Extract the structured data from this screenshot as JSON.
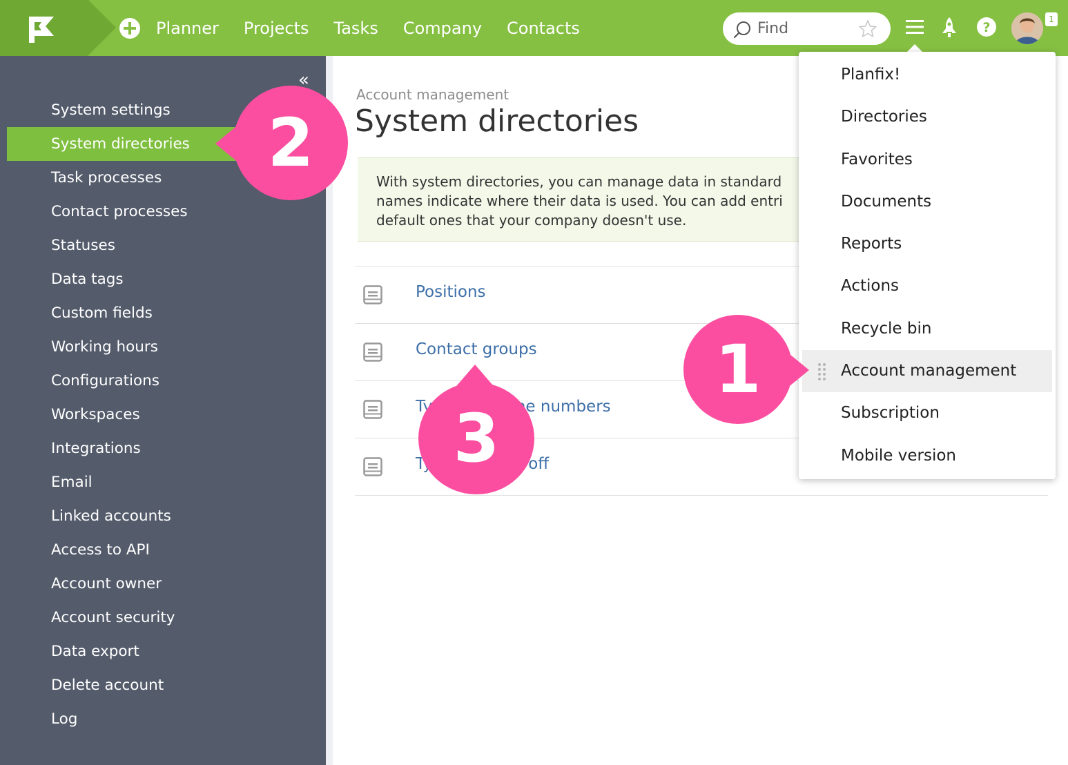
{
  "topbar": {
    "nav": [
      "Planner",
      "Projects",
      "Tasks",
      "Company",
      "Contacts"
    ],
    "search_placeholder": "Find",
    "notification_count": "1"
  },
  "sidebar": {
    "items": [
      "System settings",
      "System directories",
      "Task processes",
      "Contact processes",
      "Statuses",
      "Data tags",
      "Custom fields",
      "Working hours",
      "Configurations",
      "Workspaces",
      "Integrations",
      "Email",
      "Linked accounts",
      "Access to API",
      "Account owner",
      "Account security",
      "Data export",
      "Delete account",
      "Log"
    ],
    "active_index": 1
  },
  "main": {
    "breadcrumb": "Account management",
    "title": "System directories",
    "info_lines": [
      "With system directories, you can manage data in standard",
      "names indicate where their data is used. You can add entri",
      "default ones that your company doesn't use."
    ],
    "directories": [
      "Positions",
      "Contact groups",
      "Types of phone numbers",
      "Types of days off"
    ]
  },
  "menu": {
    "items": [
      "Planfix!",
      "Directories",
      "Favorites",
      "Documents",
      "Reports",
      "Actions",
      "Recycle bin",
      "Account management",
      "Subscription",
      "Mobile version"
    ],
    "hover_index": 7
  },
  "callouts": {
    "one": "1",
    "two": "2",
    "three": "3"
  },
  "colors": {
    "topbar": "#86c043",
    "sidebar": "#545b6b",
    "active": "#7fbf3f",
    "callout": "#fb4ea0",
    "link": "#3d6fa8"
  }
}
